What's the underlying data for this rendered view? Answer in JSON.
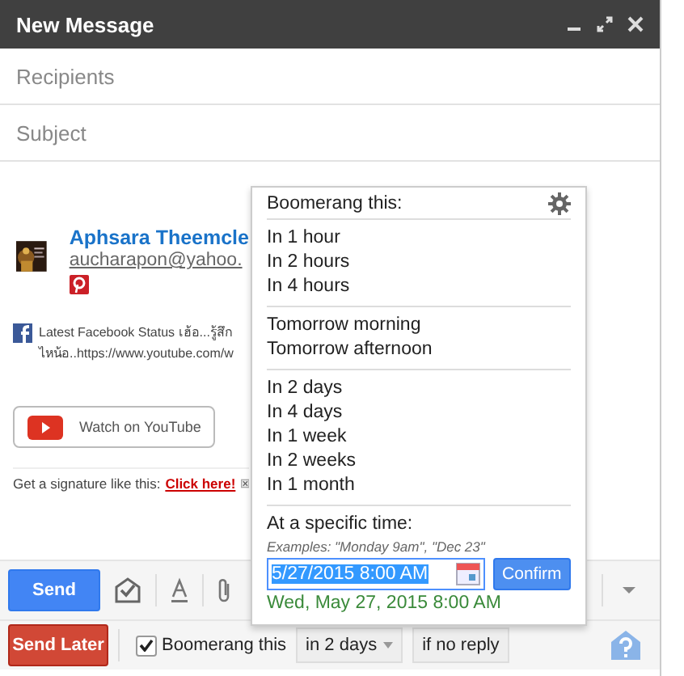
{
  "window": {
    "title": "New Message"
  },
  "fields": [
    {
      "placeholder": "Recipients"
    },
    {
      "placeholder": "Subject"
    }
  ],
  "signature": {
    "name": "Aphsara Theemcle",
    "email": "aucharapon@yahoo.",
    "status_lines": [
      "Latest Facebook Status เฮ้อ...รู้สึก",
      "ไหน้อ..https://www.youtube.com/w"
    ],
    "video_button": "Watch on YouTube",
    "promo": "Get a signature like this:",
    "promo_link": "Click here!"
  },
  "boomerang_menu": {
    "title": "Boomerang this:",
    "groups": [
      [
        "In 1 hour",
        "In 2 hours",
        "In 4 hours"
      ],
      [
        "Tomorrow morning",
        "Tomorrow afternoon"
      ],
      [
        "In 2 days",
        "In 4 days",
        "In 1 week",
        "In 2 weeks",
        "In 1 month"
      ]
    ],
    "specific_label": "At a specific time:",
    "examples": "Examples: \"Monday 9am\", \"Dec 23\"",
    "date_value": "5/27/2015 8:00 AM",
    "confirm": "Confirm",
    "parsed": "Wed, May 27, 2015 8:00 AM"
  },
  "toolbar": {
    "send": "Send"
  },
  "bottom_bar": {
    "send_later": "Send Later",
    "boomerang_checked": true,
    "boomerang_label": "Boomerang this",
    "delay": "in 2 days",
    "condition": "if no reply"
  }
}
